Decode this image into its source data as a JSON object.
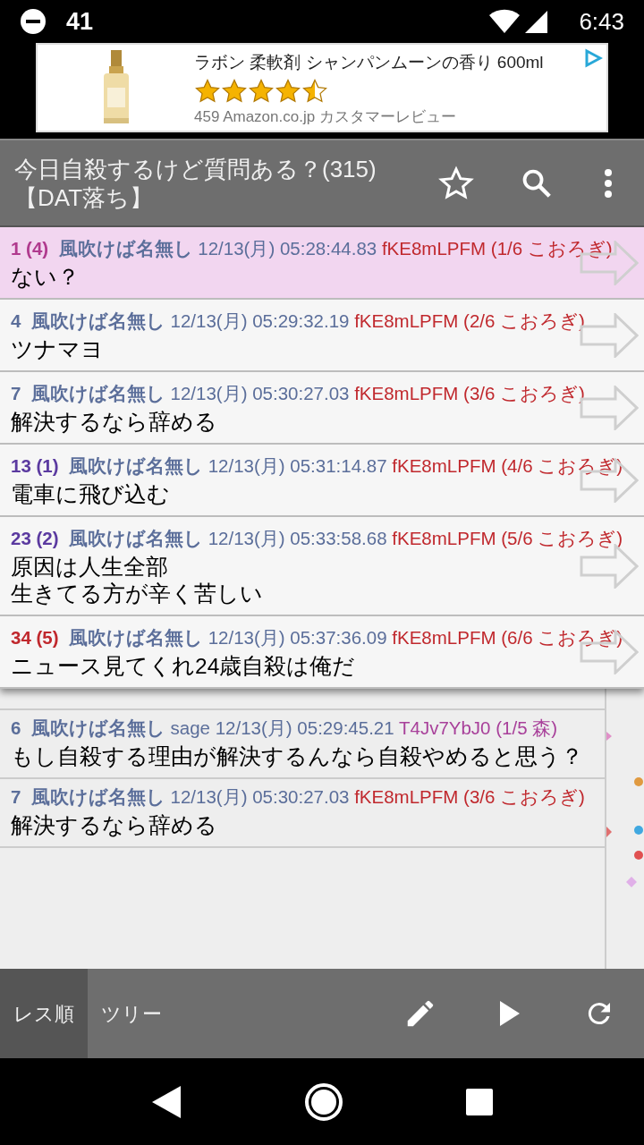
{
  "status_bar": {
    "notification_count": "41",
    "time": "6:43"
  },
  "ad": {
    "title": "ラボン 柔軟剤 シャンパンムーンの香り 600ml",
    "stars": 4.5,
    "reviews": "459 Amazon.co.jp カスタマーレビュー"
  },
  "header": {
    "title": "今日自殺するけど質問ある？(315)",
    "subtitle": "【DAT落ち】"
  },
  "popup_posts": [
    {
      "number": {
        "text": "1 (4)",
        "color": "#b03a8e"
      },
      "name": "風吹けば名無し",
      "date": "12/13(月) 05:28:44.83",
      "id": {
        "text": "fKE8mLPFM (1/6 こおろぎ)",
        "color": "#c0282d"
      },
      "body": [
        "ない？"
      ],
      "selected": true
    },
    {
      "number": {
        "text": "4",
        "color": "#5b6e9a"
      },
      "name": "風吹けば名無し",
      "date": "12/13(月) 05:29:32.19",
      "id": {
        "text": "fKE8mLPFM (2/6 こおろぎ)",
        "color": "#c0282d"
      },
      "body": [
        "ツナマヨ"
      ],
      "selected": false
    },
    {
      "number": {
        "text": "7",
        "color": "#5b6e9a"
      },
      "name": "風吹けば名無し",
      "date": "12/13(月) 05:30:27.03",
      "id": {
        "text": "fKE8mLPFM (3/6 こおろぎ)",
        "color": "#c0282d"
      },
      "body": [
        "解決するなら辞める"
      ],
      "selected": false
    },
    {
      "number": {
        "text": "13 (1)",
        "color": "#5b3aa0"
      },
      "name": "風吹けば名無し",
      "date": "12/13(月) 05:31:14.87",
      "id": {
        "text": "fKE8mLPFM (4/6 こおろぎ)",
        "color": "#c0282d"
      },
      "body": [
        "電車に飛び込む"
      ],
      "selected": false
    },
    {
      "number": {
        "text": "23 (2)",
        "color": "#5b3aa0"
      },
      "name": "風吹けば名無し",
      "date": "12/13(月) 05:33:58.68",
      "id": {
        "text": "fKE8mLPFM (5/6 こおろぎ)",
        "color": "#c0282d"
      },
      "body": [
        "原因は人生全部",
        "生きてる方が辛く苦しい"
      ],
      "selected": false
    },
    {
      "number": {
        "text": "34 (5)",
        "color": "#c0282d"
      },
      "name": "風吹けば名無し",
      "date": "12/13(月) 05:37:36.09",
      "id": {
        "text": "fKE8mLPFM (6/6 こおろぎ)",
        "color": "#c0282d"
      },
      "body": [
        "ニュース見てくれ24歳自殺は俺だ"
      ],
      "selected": false
    }
  ],
  "thread_posts": [
    {
      "number": {
        "text": "6",
        "color": "#5b6e9a"
      },
      "name": "風吹けば名無し",
      "mail": "sage",
      "date": "12/13(月) 05:29:45.21",
      "id": {
        "text": "T4Jv7YbJ0 (1/5 森)",
        "color": "#a8409a"
      },
      "body": [
        "もし自殺する理由が解決するんなら自殺やめると思う？"
      ]
    },
    {
      "number": {
        "text": "7",
        "color": "#5b6e9a"
      },
      "name": "風吹けば名無し",
      "date": "12/13(月) 05:30:27.03",
      "id": {
        "text": "fKE8mLPFM (3/6 こおろぎ)",
        "color": "#c0282d"
      },
      "body": [
        "解決するなら辞める"
      ]
    }
  ],
  "bottom_tabs": [
    {
      "label": "レス順",
      "selected": true
    },
    {
      "label": "ツリー",
      "selected": false
    }
  ]
}
